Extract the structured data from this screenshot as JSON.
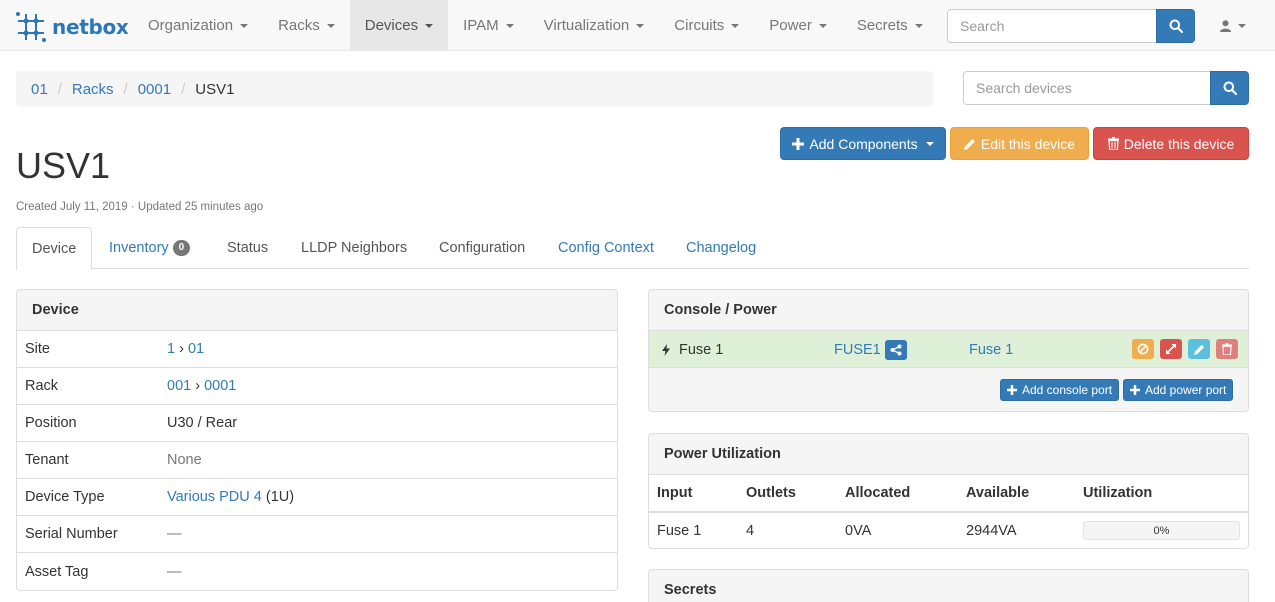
{
  "brand": {
    "name": "netbox"
  },
  "nav": {
    "items": [
      {
        "label": "Organization"
      },
      {
        "label": "Racks"
      },
      {
        "label": "Devices",
        "active": true
      },
      {
        "label": "IPAM"
      },
      {
        "label": "Virtualization"
      },
      {
        "label": "Circuits"
      },
      {
        "label": "Power"
      },
      {
        "label": "Secrets"
      }
    ],
    "search_placeholder": "Search"
  },
  "breadcrumb": {
    "items": [
      "01",
      "Racks",
      "0001"
    ],
    "current": "USV1"
  },
  "device_search": {
    "placeholder": "Search devices"
  },
  "actions": {
    "add_components": "Add Components",
    "edit": "Edit this device",
    "delete": "Delete this device"
  },
  "page": {
    "title": "USV1",
    "subtitle": "Created July 11, 2019 · Updated 25 minutes ago"
  },
  "tabs": [
    {
      "label": "Device",
      "active": true
    },
    {
      "label": "Inventory",
      "badge": "0"
    },
    {
      "label": "Status"
    },
    {
      "label": "LLDP Neighbors"
    },
    {
      "label": "Configuration"
    },
    {
      "label": "Config Context"
    },
    {
      "label": "Changelog"
    }
  ],
  "device_panel": {
    "heading": "Device",
    "site": {
      "key": "Site",
      "region": "1",
      "arrow": "›",
      "site": "01"
    },
    "rack": {
      "key": "Rack",
      "group": "001",
      "arrow": "›",
      "rack": "0001"
    },
    "position": {
      "key": "Position",
      "value": "U30 / Rear"
    },
    "tenant": {
      "key": "Tenant",
      "value": "None"
    },
    "device_type": {
      "key": "Device Type",
      "link": "Various PDU 4",
      "suffix": "(1U)"
    },
    "serial": {
      "key": "Serial Number",
      "value": "—"
    },
    "asset_tag": {
      "key": "Asset Tag",
      "value": "—"
    }
  },
  "console_power": {
    "heading": "Console / Power",
    "port": {
      "name": "Fuse 1",
      "peer_device": "FUSE1",
      "peer_port": "Fuse 1"
    },
    "add_console_port": "Add console port",
    "add_power_port": "Add power port"
  },
  "power_utilization": {
    "heading": "Power Utilization",
    "columns": [
      "Input",
      "Outlets",
      "Allocated",
      "Available",
      "Utilization"
    ],
    "rows": [
      {
        "input": "Fuse 1",
        "outlets": "4",
        "allocated": "0VA",
        "available": "2944VA",
        "utilization": "0%",
        "utilization_value": 0
      }
    ]
  },
  "secrets": {
    "heading": "Secrets"
  },
  "colors": {
    "primary": "#337ab7",
    "warning": "#f0ad4e",
    "danger": "#d9534f",
    "info": "#5bc0de",
    "success_bg": "#dff0d8"
  }
}
